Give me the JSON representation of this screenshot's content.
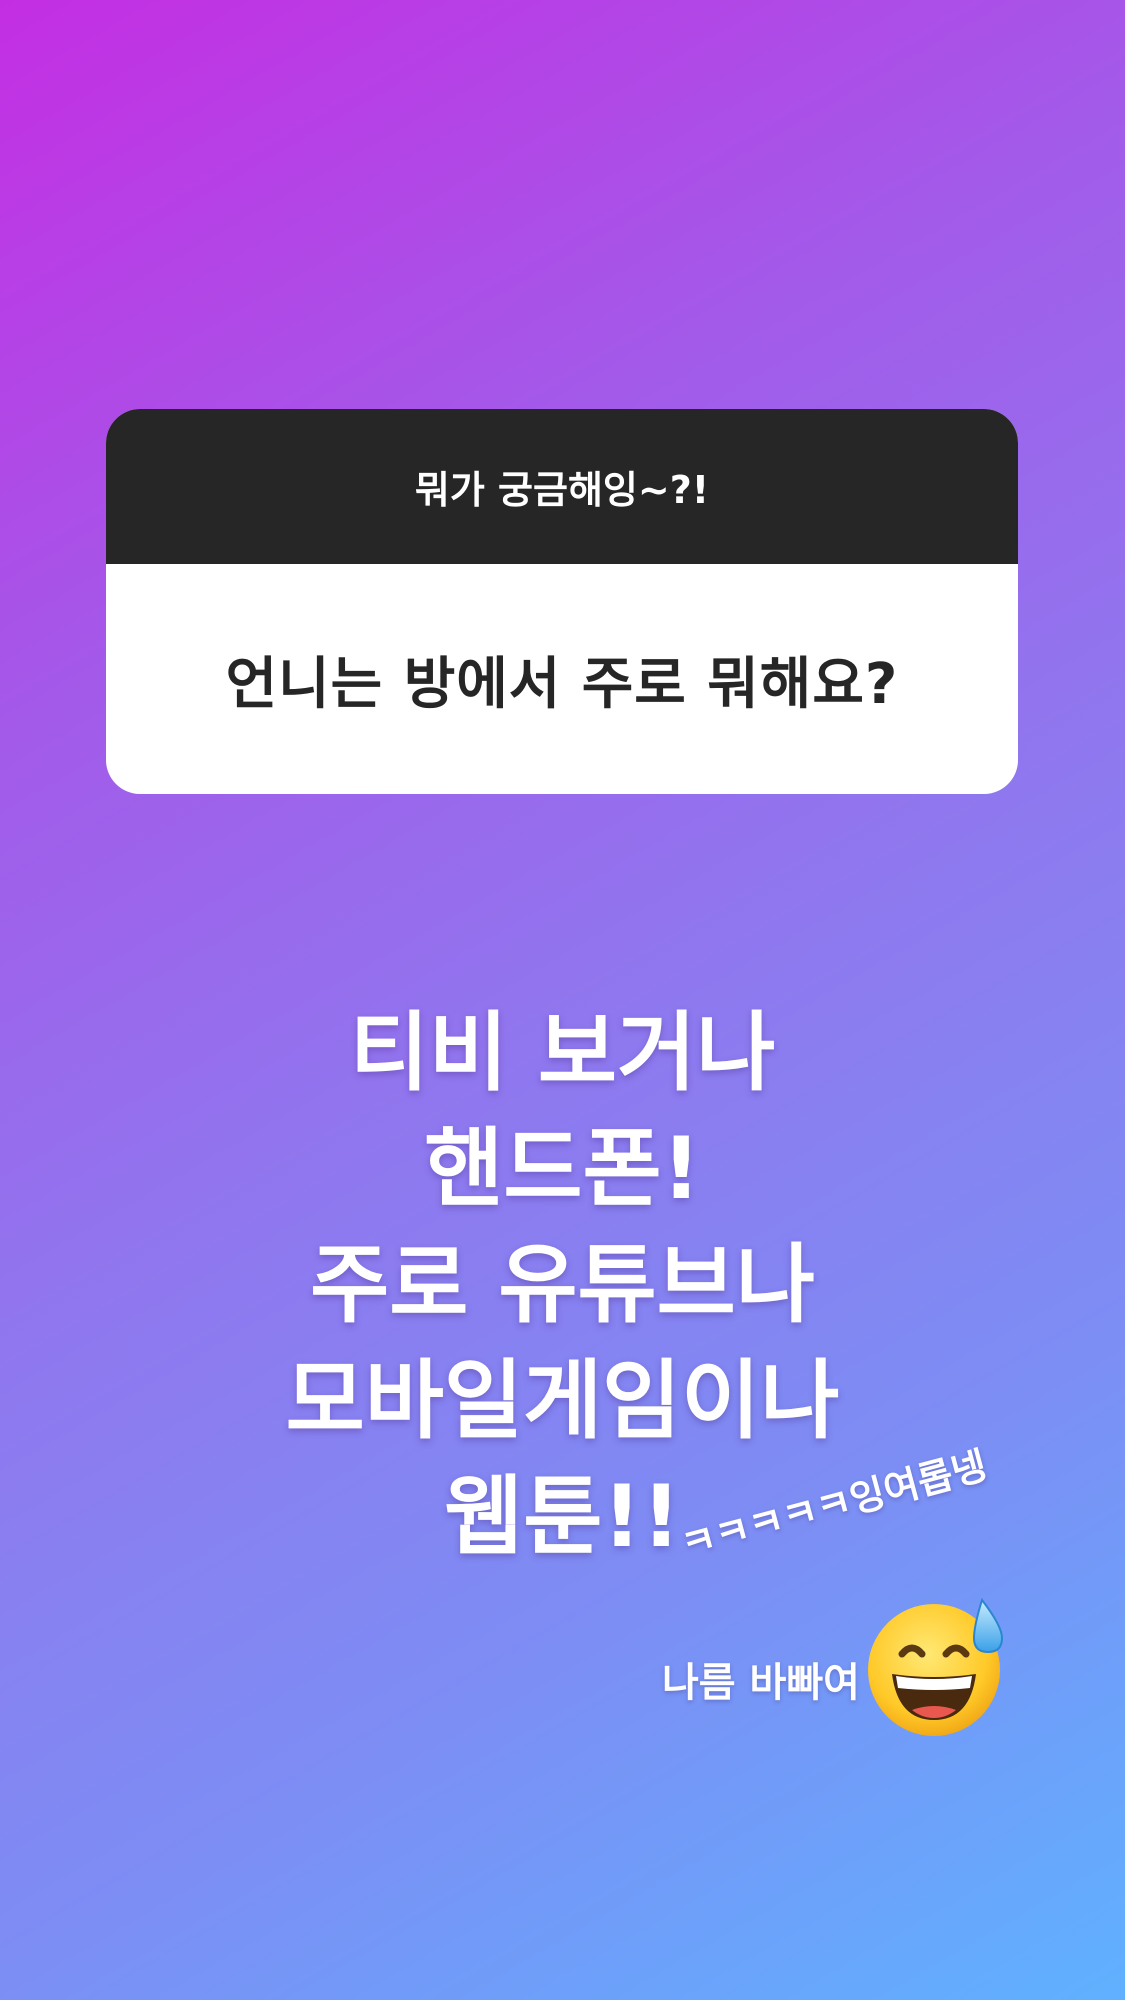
{
  "question_sticker": {
    "prompt": "뭐가 궁금해잉~?!",
    "question": "언니는 방에서 주로 뭐해요?"
  },
  "answer_lines": [
    "티비 보거나",
    "핸드폰!",
    "주로 유튜브나",
    "모바일게임이나",
    "웹툰!!"
  ],
  "side_text": {
    "laugh": "ㅋㅋㅋㅋㅋ잉여롭넹",
    "busy": "나름 바빠여"
  },
  "emoji": "grinning-face-with-sweat-icon",
  "colors": {
    "gradient_start": "#c42ee3",
    "gradient_end": "#5fb1ff",
    "card_header": "#262626",
    "card_body": "#ffffff"
  }
}
